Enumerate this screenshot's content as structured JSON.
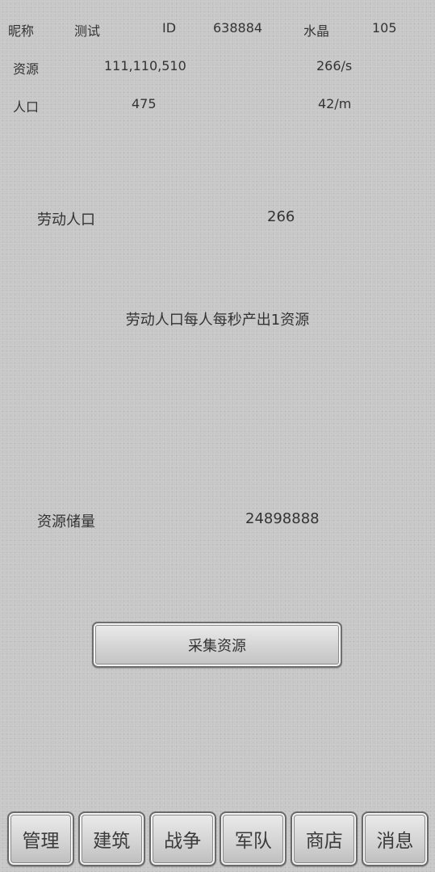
{
  "header": {
    "nickname_label": "昵称",
    "nickname_value": "测试",
    "id_label": "ID",
    "id_value": "638884",
    "crystal_label": "水晶",
    "crystal_value": "105"
  },
  "resources": {
    "label": "资源",
    "value": "111,110,510",
    "rate": "266/s"
  },
  "population": {
    "label": "人口",
    "value": "475",
    "rate": "42/m"
  },
  "labor": {
    "label": "劳动人口",
    "value": "266",
    "description": "劳动人口每人每秒产出1资源"
  },
  "storage": {
    "label": "资源储量",
    "value": "24898888"
  },
  "collect_button": "采集资源",
  "nav": [
    {
      "label": "管理"
    },
    {
      "label": "建筑"
    },
    {
      "label": "战争"
    },
    {
      "label": "军队"
    },
    {
      "label": "商店"
    },
    {
      "label": "消息"
    }
  ]
}
